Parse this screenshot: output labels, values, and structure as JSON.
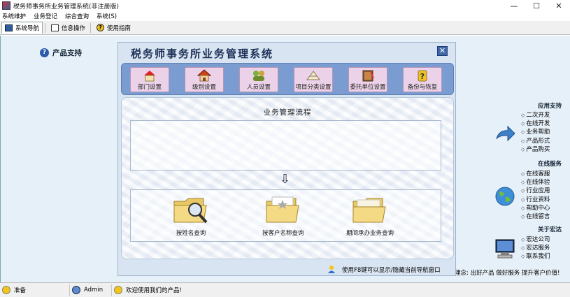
{
  "window": {
    "title": "税务师事务所业务管理系统(非注册版)",
    "controls": [
      "—",
      "☐",
      "✕"
    ]
  },
  "menu": [
    "系统维护",
    "业务登记",
    "综合查询",
    "系统(S)"
  ],
  "tabs": [
    {
      "label": "系统导航",
      "icon": "monitor-icon",
      "active": true
    },
    {
      "label": "信息操作",
      "icon": "document-icon",
      "active": false
    },
    {
      "label": "使用指南",
      "icon": "help-icon",
      "active": false
    }
  ],
  "navigator": {
    "title": "税务师事务所业务管理系统",
    "close": "✕",
    "tools": [
      {
        "label": "部门设置",
        "icon": "department-icon"
      },
      {
        "label": "级别设置",
        "icon": "house-icon"
      },
      {
        "label": "人员设置",
        "icon": "people-icon"
      },
      {
        "label": "项目分类设置",
        "icon": "project-category-icon"
      },
      {
        "label": "委托单位设置",
        "icon": "client-unit-icon"
      },
      {
        "label": "备份与恢复",
        "icon": "backup-icon"
      }
    ],
    "flow_title": "业务管理流程",
    "arrow": "⇩",
    "queries": [
      {
        "label": "按姓名查询",
        "icon": "folder-search-icon"
      },
      {
        "label": "按客户名称查询",
        "icon": "folder-star-icon"
      },
      {
        "label": "期间承办业务查询",
        "icon": "folder-open-icon"
      }
    ],
    "hint": "使用F8键可以显示/隐藏当前导航窗口"
  },
  "right_panel": {
    "title": "产品支持",
    "sections": [
      {
        "heading": "应用支持",
        "items": [
          "二次开发",
          "在线开发",
          "业务帮助",
          "产品形式",
          "产品购买"
        ],
        "icon": "arrow-icon"
      },
      {
        "heading": "在线服务",
        "items": [
          "在线客服",
          "在线体验",
          "行业应用",
          "行业资料",
          "帮助中心",
          "在线留言"
        ],
        "icon": "globe-icon"
      },
      {
        "heading": "关于宏达",
        "items": [
          "宏达公司",
          "宏达服务",
          "联系我们"
        ],
        "icon": "computer-icon"
      }
    ],
    "marquee": "理念: 出好产品  做好服务  提升客户价值!"
  },
  "status": {
    "state": "准备",
    "user": "Admin",
    "welcome": "欢迎使用我们的产品!"
  },
  "colors": {
    "main_bg": "#e6f0f8",
    "toolstrip": "#7b9cd0",
    "tool_bg": "#ecd2e8",
    "title_text": "#1c2f55"
  }
}
